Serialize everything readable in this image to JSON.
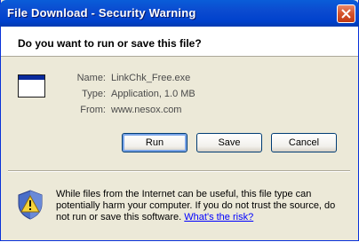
{
  "window": {
    "title": "File Download - Security Warning",
    "close_icon": "close-icon"
  },
  "header": {
    "question": "Do you want to run or save this file?"
  },
  "file": {
    "icon": "application-window-icon",
    "name_label": "Name:",
    "name_value": "LinkChk_Free.exe",
    "type_label": "Type:",
    "type_value": "Application, 1.0 MB",
    "from_label": "From:",
    "from_value": "www.nesox.com"
  },
  "buttons": {
    "run": "Run",
    "save": "Save",
    "cancel": "Cancel"
  },
  "warning": {
    "icon": "security-shield-icon",
    "text": "While files from the Internet can be useful, this file type can potentially harm your computer. If you do not trust the source, do not run or save this software.",
    "link": "What's the risk?"
  }
}
